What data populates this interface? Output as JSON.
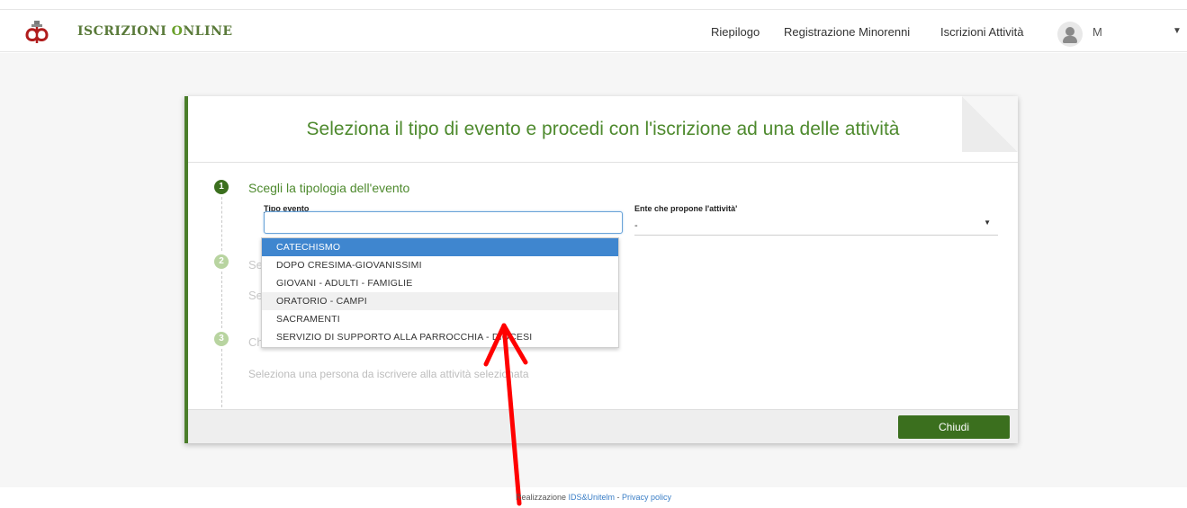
{
  "header": {
    "brand_part1": "ISCRIZIONI ",
    "brand_o": "O",
    "brand_part2": "NLINE",
    "nav": {
      "riepilogo": "Riepilogo",
      "registrazione": "Registrazione Minorenni",
      "iscrizioni": "Iscrizioni Attività"
    },
    "user_name": "M",
    "user_caret": "▼"
  },
  "modal": {
    "title": "Seleziona il tipo di evento e procedi con l'iscrizione ad una delle attività",
    "steps": [
      {
        "number": "1",
        "title": "Scegli la tipologia dell'evento"
      },
      {
        "number": "2",
        "title": "Se",
        "subtitle": "Se"
      },
      {
        "number": "3",
        "title": "Ch",
        "subtitle": "Seleziona una persona da iscrivere alla attività selezionata"
      }
    ],
    "fields": {
      "tipo_evento_label": "Tipo evento",
      "tipo_evento_value": "",
      "ente_label": "Ente che propone l'attività'",
      "ente_value": "-"
    },
    "dropdown_options": [
      "CATECHISMO",
      "DOPO CRESIMA-GIOVANISSIMI",
      "GIOVANI - ADULTI - FAMIGLIE",
      "ORATORIO - CAMPI",
      "SACRAMENTI",
      "SERVIZIO DI SUPPORTO ALLA PARROCCHIA - DIOCESI"
    ],
    "selected_option": "CATECHISMO",
    "hovered_option": "ORATORIO - CAMPI",
    "close_label": "Chiudi"
  },
  "footer": {
    "prefix": "Realizzazione ",
    "link1": "IDS&Unitelm",
    "separator": " - ",
    "link2": "Privacy policy"
  },
  "colors": {
    "brand_green": "#4e8a2e",
    "button_green": "#3b6f1e",
    "selected_blue": "#3f86cf",
    "arrow_red": "#ff0000"
  }
}
